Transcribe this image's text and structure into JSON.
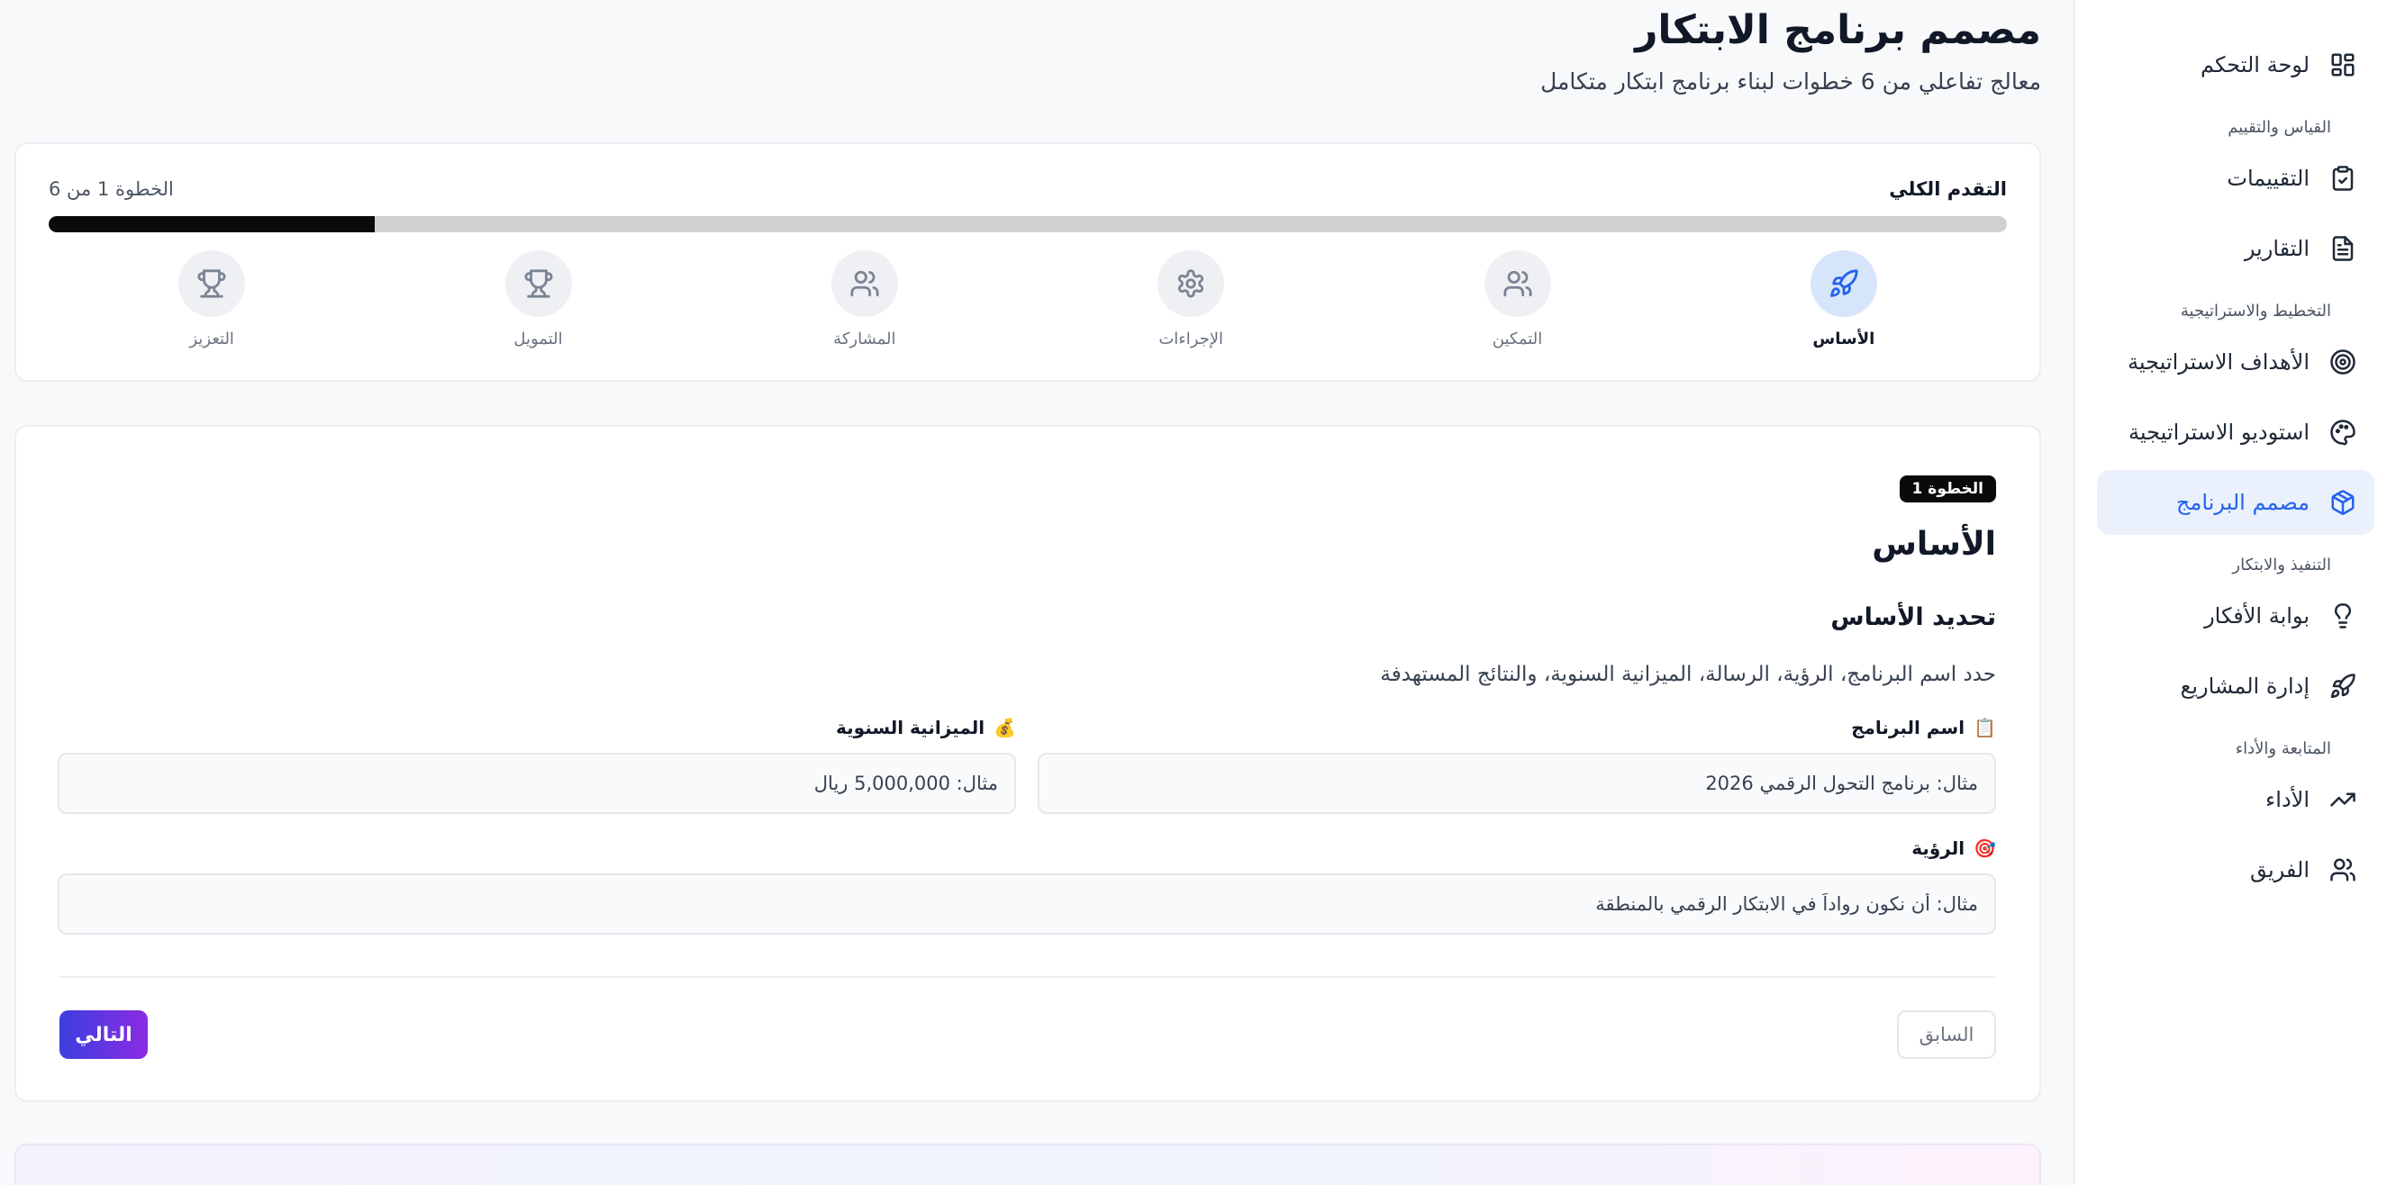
{
  "page": {
    "title": "مصمم برنامج الابتكار",
    "subtitle": "معالج تفاعلي من 6 خطوات لبناء برنامج ابتكار متكامل"
  },
  "sidebar": {
    "dashboard": {
      "label": "لوحة التحكم",
      "icon": "dashboard-grid-icon"
    },
    "sections": [
      {
        "title": "القياس والتقييم",
        "items": [
          {
            "label": "التقييمات",
            "icon": "clipboard-check-icon"
          },
          {
            "label": "التقارير",
            "icon": "document-icon"
          }
        ]
      },
      {
        "title": "التخطيط والاستراتيجية",
        "items": [
          {
            "label": "الأهداف الاستراتيجية",
            "icon": "target-icon"
          },
          {
            "label": "استوديو الاستراتيجية",
            "icon": "palette-icon"
          },
          {
            "label": "مصمم البرنامج",
            "icon": "cube-icon",
            "active": true
          }
        ]
      },
      {
        "title": "التنفيذ والابتكار",
        "items": [
          {
            "label": "بوابة الأفكار",
            "icon": "lightbulb-icon"
          },
          {
            "label": "إدارة المشاريع",
            "icon": "rocket-icon"
          }
        ]
      },
      {
        "title": "المتابعة والأداء",
        "items": [
          {
            "label": "الأداء",
            "icon": "trending-up-icon"
          },
          {
            "label": "الفريق",
            "icon": "users-icon"
          }
        ]
      }
    ]
  },
  "progress": {
    "title": "التقدم الكلي",
    "step_text": "الخطوة 1 من 6",
    "fraction": 0.1667,
    "steps": [
      {
        "label": "الأساس",
        "icon": "rocket-icon",
        "active": true
      },
      {
        "label": "التمكين",
        "icon": "users-icon"
      },
      {
        "label": "الإجراءات",
        "icon": "gear-icon"
      },
      {
        "label": "المشاركة",
        "icon": "users-icon"
      },
      {
        "label": "التمويل",
        "icon": "trophy-icon"
      },
      {
        "label": "التعزيز",
        "icon": "trophy-icon"
      }
    ]
  },
  "form": {
    "badge": "الخطوة 1",
    "title": "الأساس",
    "subtitle": "تحديد الأساس",
    "description": "حدد اسم البرنامج، الرؤية، الرسالة، الميزانية السنوية، والنتائج المستهدفة",
    "fields": {
      "program_name": {
        "emoji": "📋",
        "label": "اسم البرنامج",
        "placeholder": "مثال: برنامج التحول الرقمي 2026"
      },
      "annual_budget": {
        "emoji": "💰",
        "label": "الميزانية السنوية",
        "placeholder": "مثال: 5,000,000 ريال"
      },
      "vision": {
        "emoji": "🎯",
        "label": "الرؤية",
        "placeholder": "مثال: أن نكون رواداً في الابتكار الرقمي بالمنطقة"
      }
    },
    "prev_label": "السابق",
    "next_label": "التالي"
  },
  "colors": {
    "accent": "#2563eb",
    "active_bg": "#eaf1fd",
    "progress_fill": "#0a0a0a",
    "next_gradient_start": "#3b3fe0",
    "next_gradient_end": "#8b2be2"
  }
}
